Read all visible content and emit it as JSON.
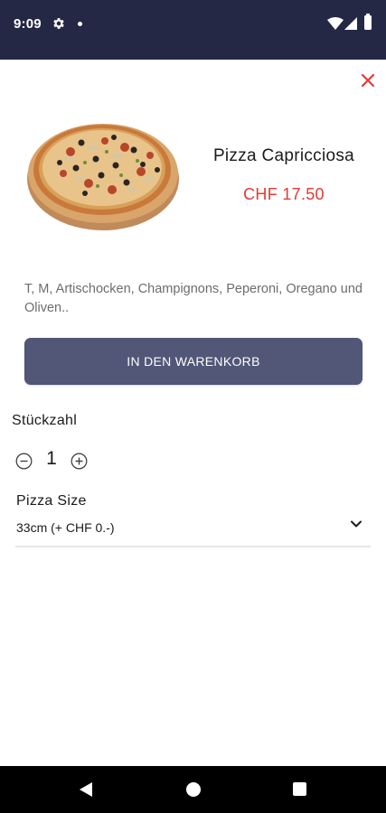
{
  "status_bar": {
    "time": "9:09",
    "background_color": "#252845",
    "icons": [
      "gear-icon",
      "dot-icon",
      "wifi-icon",
      "signal-icon",
      "battery-icon"
    ]
  },
  "close": {
    "icon": "close-icon",
    "color": "#e53935"
  },
  "product": {
    "image": "pizza-image",
    "name": "Pizza Capricciosa",
    "price": "CHF 17.50",
    "price_color": "#e53935",
    "description": "T, M, Artischocken, Champignons, Peperoni, Oregano und Oliven.."
  },
  "cart": {
    "add_label": "IN DEN WARENKORB",
    "button_color": "#525677"
  },
  "quantity": {
    "label": "Stückzahl",
    "value": "1",
    "icons": [
      "minus-circle-icon",
      "plus-circle-icon"
    ]
  },
  "size": {
    "label": "Pizza Size",
    "selected": "33cm (+ CHF 0.-)",
    "icon": "chevron-down-icon"
  },
  "nav_bar": {
    "icons": [
      "back-icon",
      "home-icon",
      "recents-icon"
    ]
  }
}
